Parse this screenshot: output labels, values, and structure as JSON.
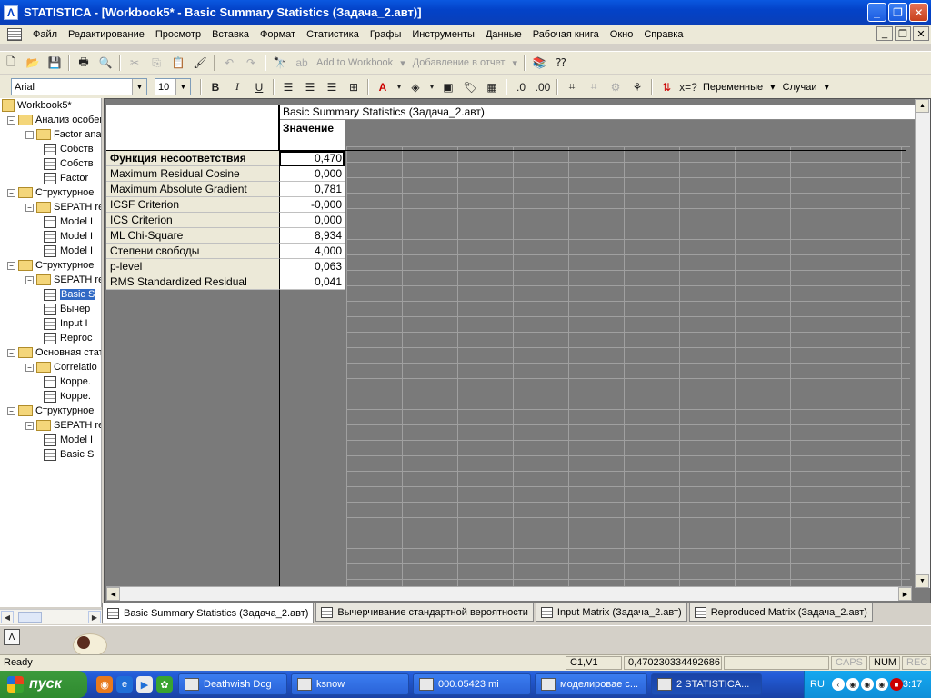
{
  "window": {
    "title": "STATISTICA - [Workbook5* - Basic Summary Statistics (Задача_2.авт)]",
    "app_icon": "statistica-icon"
  },
  "menu": [
    "Файл",
    "Редактирование",
    "Просмотр",
    "Вставка",
    "Формат",
    "Статистика",
    "Графы",
    "Инструменты",
    "Данные",
    "Рабочая книга",
    "Окно",
    "Справка"
  ],
  "toolbar1": {
    "add_to_workbook": "Add to Workbook",
    "add_to_report": "Добавление в отчет"
  },
  "toolbar2": {
    "font_name": "Arial",
    "font_size": "10",
    "bold": "B",
    "italic": "I",
    "underline": "U",
    "variables": "Переменные",
    "cases": "Случаи"
  },
  "tree": [
    {
      "label": "Workbook5*",
      "level": 0,
      "type": "workbook",
      "expander": ""
    },
    {
      "label": "Анализ особен",
      "level": 1,
      "type": "folder",
      "expander": "−"
    },
    {
      "label": "Factor ana",
      "level": 2,
      "type": "folder",
      "expander": "−"
    },
    {
      "label": "Собств",
      "level": 3,
      "type": "sheet",
      "expander": ""
    },
    {
      "label": "Собств",
      "level": 3,
      "type": "sheet",
      "expander": ""
    },
    {
      "label": "Factor",
      "level": 3,
      "type": "sheet",
      "expander": ""
    },
    {
      "label": "Структурное",
      "level": 1,
      "type": "folder",
      "expander": "−"
    },
    {
      "label": "SEPATH re",
      "level": 2,
      "type": "folder",
      "expander": "−"
    },
    {
      "label": "Model I",
      "level": 3,
      "type": "sheet",
      "expander": ""
    },
    {
      "label": "Model I",
      "level": 3,
      "type": "sheet",
      "expander": ""
    },
    {
      "label": "Model I",
      "level": 3,
      "type": "sheet",
      "expander": ""
    },
    {
      "label": "Структурное",
      "level": 1,
      "type": "folder",
      "expander": "−"
    },
    {
      "label": "SEPATH re",
      "level": 2,
      "type": "folder",
      "expander": "−"
    },
    {
      "label": "Basic S",
      "level": 3,
      "type": "sheet",
      "expander": "",
      "selected": true
    },
    {
      "label": "Вычер",
      "level": 3,
      "type": "sheet",
      "expander": ""
    },
    {
      "label": "Input I",
      "level": 3,
      "type": "sheet",
      "expander": ""
    },
    {
      "label": "Reproc",
      "level": 3,
      "type": "sheet",
      "expander": ""
    },
    {
      "label": "Основная стат",
      "level": 1,
      "type": "folder",
      "expander": "−"
    },
    {
      "label": "Correlatio",
      "level": 2,
      "type": "folder",
      "expander": "−"
    },
    {
      "label": "Корре.",
      "level": 3,
      "type": "sheet",
      "expander": ""
    },
    {
      "label": "Корре.",
      "level": 3,
      "type": "sheet",
      "expander": ""
    },
    {
      "label": "Структурное",
      "level": 1,
      "type": "folder",
      "expander": "−"
    },
    {
      "label": "SEPATH re",
      "level": 2,
      "type": "folder",
      "expander": "−"
    },
    {
      "label": "Model I",
      "level": 3,
      "type": "sheet",
      "expander": ""
    },
    {
      "label": "Basic S",
      "level": 3,
      "type": "sheet",
      "expander": ""
    }
  ],
  "spreadsheet": {
    "title": "Basic Summary Statistics (Задача_2.авт)",
    "column_header": "Значение",
    "rows": [
      {
        "name": "Функция несоответствия",
        "value": "0,470",
        "bold": true
      },
      {
        "name": "Maximum Residual Cosine",
        "value": "0,000"
      },
      {
        "name": "Maximum Absolute Gradient",
        "value": "0,781"
      },
      {
        "name": "ICSF Criterion",
        "value": "-0,000"
      },
      {
        "name": "ICS Criterion",
        "value": "0,000"
      },
      {
        "name": "ML Chi-Square",
        "value": "8,934"
      },
      {
        "name": "Степени свободы",
        "value": "4,000"
      },
      {
        "name": "p-level",
        "value": "0,063"
      },
      {
        "name": "RMS Standardized Residual",
        "value": "0,041"
      }
    ]
  },
  "tabs": [
    {
      "label": "Basic Summary Statistics (Задача_2.авт)",
      "active": true
    },
    {
      "label": "Вычерчивание стандартной вероятности"
    },
    {
      "label": "Input Matrix (Задача_2.авт)"
    },
    {
      "label": "Reproduced Matrix (Задача_2.авт)"
    }
  ],
  "status": {
    "ready": "Ready",
    "cell": "C1,V1",
    "cell_value": "0,470230334492686",
    "caps": "CAPS",
    "num": "NUM",
    "rec": "REC"
  },
  "taskbar": {
    "start": "пуск",
    "tasks": [
      {
        "label": "Deathwish Dog"
      },
      {
        "label": "ksnow"
      },
      {
        "label": "000.05423 mi"
      },
      {
        "label": "моделировае с..."
      },
      {
        "label": "2 STATISTICA...",
        "active": true
      }
    ],
    "lang": "RU",
    "clock": "3:17"
  }
}
